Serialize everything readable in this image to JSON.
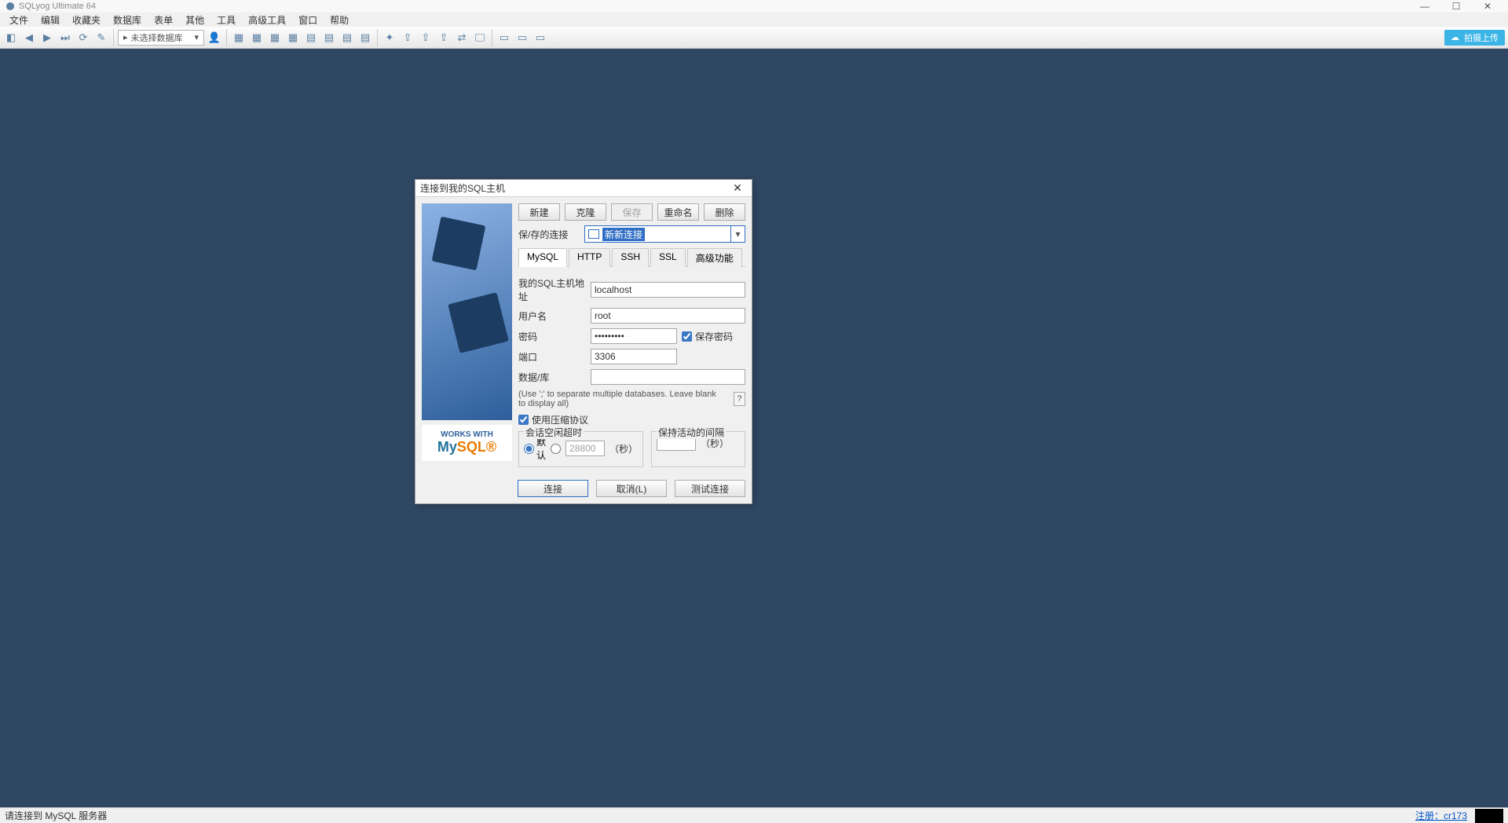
{
  "titlebar": {
    "app_name": "SQLyog Ultimate 64"
  },
  "menubar": {
    "items": [
      "文件",
      "编辑",
      "收藏夹",
      "数据库",
      "表单",
      "其他",
      "工具",
      "高级工具",
      "窗口",
      "帮助"
    ]
  },
  "toolbar": {
    "db_placeholder": "未选择数据库",
    "cloud_label": "拍摄上传"
  },
  "statusbar": {
    "message": "请连接到 MySQL 服务器",
    "register_label": "注册：cr173"
  },
  "dialog": {
    "title": "连接到我的SQL主机",
    "buttons": {
      "new": "新建",
      "clone": "克隆",
      "save": "保存",
      "rename": "重命名",
      "delete": "删除"
    },
    "saved_conn_label": "保/存的连接",
    "saved_conn_value": "新新连接",
    "tabs": [
      "MySQL",
      "HTTP",
      "SSH",
      "SSL",
      "高级功能"
    ],
    "fields": {
      "host_label": "我的SQL主机地址",
      "host_value": "localhost",
      "user_label": "用户名",
      "user_value": "root",
      "pass_label": "密码",
      "pass_value": "•••••••••",
      "save_pass_label": "保存密码",
      "port_label": "端口",
      "port_value": "3306",
      "db_label": "数据/库",
      "db_value": ""
    },
    "hint": "(Use ';' to separate multiple databases. Leave blank to display all)",
    "compress_label": "使用压缩协议",
    "idle_group": {
      "legend": "会话空闲超时",
      "default_label": "默认",
      "custom_value": "28800",
      "unit": "（秒）"
    },
    "keepalive_group": {
      "legend": "保持活动的间隔",
      "value": "",
      "unit": "（秒）"
    },
    "mysql_badge": {
      "top": "WORKS WITH",
      "brand_my": "My",
      "brand_sql": "SQL"
    },
    "bottom_buttons": {
      "connect": "连接",
      "cancel": "取消(L)",
      "test": "测试连接"
    }
  }
}
